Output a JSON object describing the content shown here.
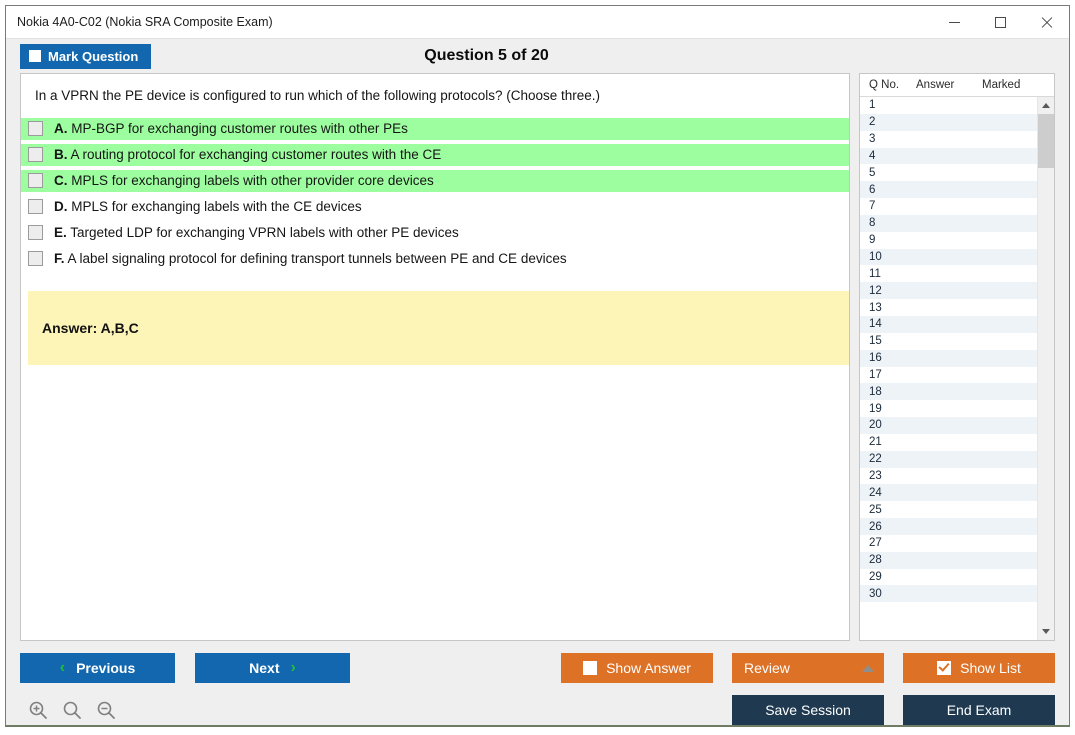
{
  "window": {
    "title": "Nokia 4A0-C02 (Nokia SRA Composite Exam)",
    "minimize_label": "Minimize",
    "maximize_label": "Maximize",
    "close_label": "Close"
  },
  "header": {
    "mark_question_label": "Mark Question",
    "question_title": "Question 5 of 20"
  },
  "question": {
    "text": "In a VPRN the PE device is configured to run which of the following protocols? (Choose three.)",
    "options": [
      {
        "letter": "A.",
        "text": "MP-BGP for exchanging customer routes with other PEs",
        "correct": true
      },
      {
        "letter": "B.",
        "text": "A routing protocol for exchanging customer routes with the CE",
        "correct": true
      },
      {
        "letter": "C.",
        "text": "MPLS for exchanging labels with other provider core devices",
        "correct": true
      },
      {
        "letter": "D.",
        "text": "MPLS for exchanging labels with the CE devices",
        "correct": false
      },
      {
        "letter": "E.",
        "text": "Targeted LDP for exchanging VPRN labels with other PE devices",
        "correct": false
      },
      {
        "letter": "F.",
        "text": "A label signaling protocol for defining transport tunnels between PE and CE devices",
        "correct": false
      }
    ],
    "answer_label": "Answer: A,B,C"
  },
  "list_panel": {
    "columns": [
      "Q No.",
      "Answer",
      "Marked"
    ],
    "rows": [
      {
        "qno": "1",
        "answer": "",
        "marked": ""
      },
      {
        "qno": "2",
        "answer": "",
        "marked": ""
      },
      {
        "qno": "3",
        "answer": "",
        "marked": ""
      },
      {
        "qno": "4",
        "answer": "",
        "marked": ""
      },
      {
        "qno": "5",
        "answer": "",
        "marked": ""
      },
      {
        "qno": "6",
        "answer": "",
        "marked": ""
      },
      {
        "qno": "7",
        "answer": "",
        "marked": ""
      },
      {
        "qno": "8",
        "answer": "",
        "marked": ""
      },
      {
        "qno": "9",
        "answer": "",
        "marked": ""
      },
      {
        "qno": "10",
        "answer": "",
        "marked": ""
      },
      {
        "qno": "11",
        "answer": "",
        "marked": ""
      },
      {
        "qno": "12",
        "answer": "",
        "marked": ""
      },
      {
        "qno": "13",
        "answer": "",
        "marked": ""
      },
      {
        "qno": "14",
        "answer": "",
        "marked": ""
      },
      {
        "qno": "15",
        "answer": "",
        "marked": ""
      },
      {
        "qno": "16",
        "answer": "",
        "marked": ""
      },
      {
        "qno": "17",
        "answer": "",
        "marked": ""
      },
      {
        "qno": "18",
        "answer": "",
        "marked": ""
      },
      {
        "qno": "19",
        "answer": "",
        "marked": ""
      },
      {
        "qno": "20",
        "answer": "",
        "marked": ""
      },
      {
        "qno": "21",
        "answer": "",
        "marked": ""
      },
      {
        "qno": "22",
        "answer": "",
        "marked": ""
      },
      {
        "qno": "23",
        "answer": "",
        "marked": ""
      },
      {
        "qno": "24",
        "answer": "",
        "marked": ""
      },
      {
        "qno": "25",
        "answer": "",
        "marked": ""
      },
      {
        "qno": "26",
        "answer": "",
        "marked": ""
      },
      {
        "qno": "27",
        "answer": "",
        "marked": ""
      },
      {
        "qno": "28",
        "answer": "",
        "marked": ""
      },
      {
        "qno": "29",
        "answer": "",
        "marked": ""
      },
      {
        "qno": "30",
        "answer": "",
        "marked": ""
      }
    ]
  },
  "footer": {
    "previous_label": "Previous",
    "next_label": "Next",
    "prev_chevron": "‹",
    "next_chevron": "›",
    "show_answer_label": "Show Answer",
    "show_answer_checked": false,
    "review_label": "Review",
    "show_list_label": "Show List",
    "show_list_checked": true,
    "save_session_label": "Save Session",
    "end_exam_label": "End Exam",
    "zoom_in_label": "Zoom In",
    "zoom_reset_label": "Zoom Reset",
    "zoom_out_label": "Zoom Out"
  },
  "colors": {
    "primary_blue": "#1267ae",
    "accent_orange": "#dd7126",
    "navy": "#1e3950",
    "correct_green": "#9dfe9f",
    "answer_yellow": "#fdf4b8",
    "chevron_green": "#22c03a"
  }
}
